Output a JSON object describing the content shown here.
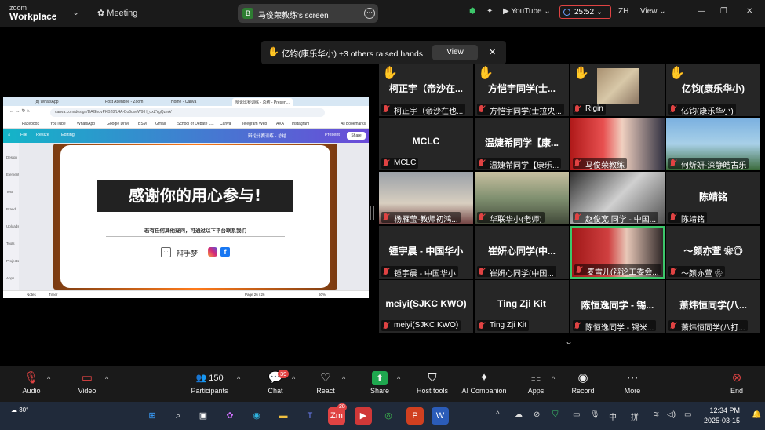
{
  "app": {
    "logo_line1": "zoom",
    "logo_line2": "Workplace",
    "meeting_label": "Meeting"
  },
  "share_pill": {
    "badge": "B",
    "title": "马俊荣教练's screen"
  },
  "topright": {
    "youtube": "YouTube",
    "timer": "25:52",
    "lang": "ZH",
    "view": "View"
  },
  "raise_banner": {
    "name": "亿钧(康乐华小)",
    "others": "+3 others raised hands",
    "view_button": "View"
  },
  "shared": {
    "tabs": [
      "(8) WhatsApp",
      "Post Attendee - Zoom",
      "Home - Canva",
      "辩论比赛训练 - 总结 - Presen..."
    ],
    "url": "canva.com/design/DAGhuvPKB28/L4A-Bo6dxeW9tH_qxZYgQzeA/",
    "bookmarks": [
      "Facebook",
      "YouTube",
      "WhatsApp",
      "Google Drive",
      "BSM",
      "Gmail",
      "School of Debate L...",
      "Canva",
      "Telegram Web",
      "AXA",
      "Instagram",
      "All Bookmarks"
    ],
    "canva_menu": [
      "File",
      "Resize",
      "Editing"
    ],
    "canva_doc": "辩论比赛训练 - 总结",
    "present": "Present",
    "share": "Share",
    "sidebar": [
      "Design",
      "Elements",
      "Text",
      "Brand",
      "Uploads",
      "Tools",
      "Projects",
      "Apps"
    ],
    "slide_title": "感谢你的用心参与!",
    "slide_sub": "若有任何其他疑问，可通过以下平台联系我们",
    "slide_brand": "辩手梦",
    "status_notes": "Notes",
    "status_timer": "Timer",
    "status_page": "Page 26 / 26",
    "status_zoom": "60%"
  },
  "participants": [
    {
      "big": "柯正宇（帝沙在...",
      "name": "柯正宇（帝沙在也...",
      "hand": true
    },
    {
      "big": "方恺宇同学(士...",
      "name": "方恺宇同学(士拉央...",
      "hand": true
    },
    {
      "big": "",
      "name": "Rigin",
      "hand": true
    },
    {
      "big": "亿钧(康乐华小)",
      "name": "亿钧(康乐华小)",
      "hand": true
    },
    {
      "big": "MCLC",
      "name": "MCLC",
      "hand": false
    },
    {
      "big": "温婕希同学【康...",
      "name": "温婕希同学【康乐...",
      "hand": false
    },
    {
      "big": "",
      "name": "马俊荣教练",
      "hand": false
    },
    {
      "big": "",
      "name": "何炘妍-深静皓古乐",
      "hand": false
    },
    {
      "big": "",
      "name": "杨雁莹-教师初鸿...",
      "hand": false
    },
    {
      "big": "",
      "name": "华联华小(老师)",
      "hand": false
    },
    {
      "big": "",
      "name": "赵俊宽 同学 - 中国...",
      "hand": false
    },
    {
      "big": "陈靖铭",
      "name": "陈靖铭",
      "hand": false
    },
    {
      "big": "锺宇晨 - 中国华小",
      "name": "锺宇晨 - 中国华小",
      "hand": false
    },
    {
      "big": "崔妍心同学(中...",
      "name": "崔妍心同学(中国...",
      "hand": false
    },
    {
      "big": "",
      "name": "麦雪儿(辩论工委会...",
      "hand": false
    },
    {
      "big": "～颜亦萱 ❀◎",
      "name": "～颜亦萱 ❀",
      "hand": false
    },
    {
      "big": "meiyi(SJKC KWO)",
      "name": "meiyi(SJKC KWO)",
      "hand": false
    },
    {
      "big": "Ting Zji Kit",
      "name": "Ting Zji Kit",
      "hand": false
    },
    {
      "big": "陈恒逸同学 - 锡...",
      "name": "陈恒逸同学 - 锡米...",
      "hand": false
    },
    {
      "big": "萧炜恒同学(八...",
      "name": "萧炜恒同学(八打...",
      "hand": false
    }
  ],
  "toolbar": {
    "audio": "Audio",
    "video": "Video",
    "participants": "Participants",
    "participants_count": "150",
    "chat": "Chat",
    "chat_badge": "39",
    "react": "React",
    "share": "Share",
    "host_tools": "Host tools",
    "ai_companion": "AI Companion",
    "apps": "Apps",
    "record": "Record",
    "more": "More",
    "end": "End"
  },
  "taskbar": {
    "weather": "30°",
    "zoom_badge": "28",
    "time": "12:34 PM",
    "date": "2025-03-15",
    "ime1": "中",
    "ime2": "拼"
  },
  "colors": {
    "raise_hand": "#f3b32a",
    "accent_green": "#3cc66a",
    "mute_red": "#e04343"
  }
}
